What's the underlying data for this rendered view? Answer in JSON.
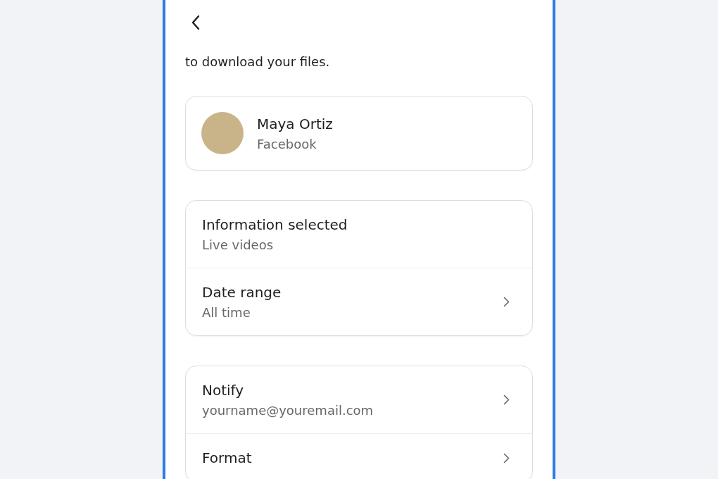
{
  "intro": "to download your files.",
  "account": {
    "name": "Maya Ortiz",
    "platform": "Facebook"
  },
  "sections": [
    {
      "rows": [
        {
          "title": "Information selected",
          "value": "Live videos",
          "chevron": false
        },
        {
          "title": "Date range",
          "value": "All time",
          "chevron": true
        }
      ]
    },
    {
      "rows": [
        {
          "title": "Notify",
          "value": "yourname@youremail.com",
          "chevron": true
        },
        {
          "title": "Format",
          "chevron": true
        }
      ]
    }
  ]
}
